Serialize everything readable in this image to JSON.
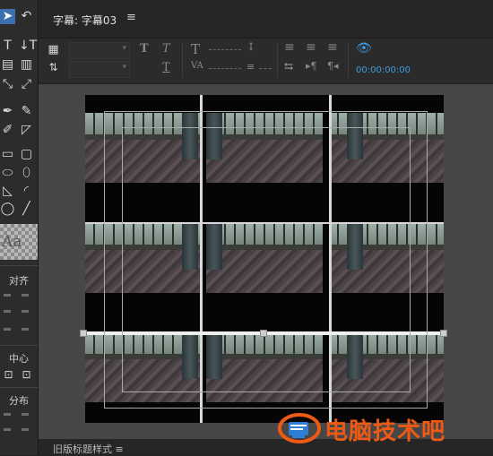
{
  "panel": {
    "title": "字幕: 字幕03",
    "menu_icon": "≡"
  },
  "tools": {
    "sections": {
      "align": "对齐",
      "center": "中心",
      "distribute": "分布"
    },
    "text_style_sample": "Aa"
  },
  "toolbar": {
    "timecode": "00:00:00:00",
    "text_t": "T",
    "text_t_italic": "T"
  },
  "bottom": {
    "title": "旧版标题样式 ≡"
  },
  "watermark": {
    "text": "电脑技术吧"
  },
  "colors": {
    "accent": "#3c9ce0",
    "watermark": "#ee5a14",
    "selected_tool": "#3b6fb0"
  }
}
